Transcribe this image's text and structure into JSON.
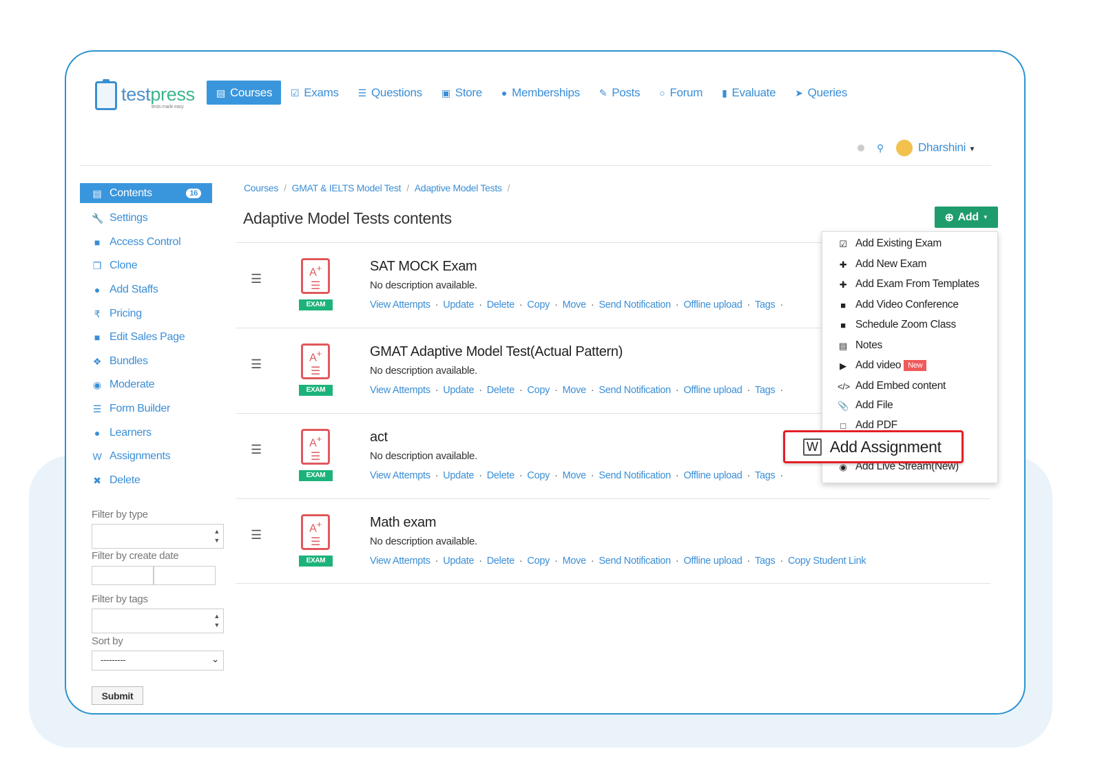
{
  "brand": {
    "name_a": "test",
    "name_b": "press",
    "tagline": "tests made easy",
    "accent": "#3a96dc",
    "green": "#1e9c6c"
  },
  "nav": [
    {
      "label": "Courses",
      "icon": "book-icon",
      "active": true
    },
    {
      "label": "Exams",
      "icon": "clipboard-check-icon"
    },
    {
      "label": "Questions",
      "icon": "list-icon"
    },
    {
      "label": "Store",
      "icon": "archive-icon"
    },
    {
      "label": "Memberships",
      "icon": "users-icon"
    },
    {
      "label": "Posts",
      "icon": "edit-icon"
    },
    {
      "label": "Forum",
      "icon": "comments-icon"
    },
    {
      "label": "Evaluate",
      "icon": "file-icon"
    },
    {
      "label": "Queries",
      "icon": "rocket-icon"
    }
  ],
  "user": {
    "name": "Dharshini"
  },
  "sidebar": {
    "items": [
      {
        "label": "Contents",
        "icon": "book-icon",
        "badge": "16",
        "active": true
      },
      {
        "label": "Settings",
        "icon": "wrench-icon"
      },
      {
        "label": "Access Control",
        "icon": "lock-icon"
      },
      {
        "label": "Clone",
        "icon": "copy-icon"
      },
      {
        "label": "Add Staffs",
        "icon": "user-plus-icon"
      },
      {
        "label": "Pricing",
        "icon": "rupee-icon"
      },
      {
        "label": "Edit Sales Page",
        "icon": "shopping-bag-icon"
      },
      {
        "label": "Bundles",
        "icon": "cubes-icon"
      },
      {
        "label": "Moderate",
        "icon": "eye-icon"
      },
      {
        "label": "Form Builder",
        "icon": "list-icon"
      },
      {
        "label": "Learners",
        "icon": "users-icon"
      },
      {
        "label": "Assignments",
        "icon": "word-file-icon"
      },
      {
        "label": "Delete",
        "icon": "times-circle-icon"
      }
    ]
  },
  "filters": {
    "type_label": "Filter by type",
    "date_label": "Filter by create date",
    "tags_label": "Filter by tags",
    "sort_label": "Sort by",
    "sort_value": "---------",
    "submit": "Submit"
  },
  "breadcrumb": [
    "Courses",
    "GMAT & IELTS Model Test",
    "Adaptive Model Tests"
  ],
  "page_title": "Adaptive Model Tests contents",
  "add_button": "Add",
  "exam_label": "EXAM",
  "rows": [
    {
      "name": "SAT MOCK Exam",
      "desc": "No description available."
    },
    {
      "name": "GMAT Adaptive Model Test(Actual Pattern)",
      "desc": "No description available."
    },
    {
      "name": "act",
      "desc": "No description available."
    },
    {
      "name": "Math exam",
      "desc": "No description available."
    }
  ],
  "actions": [
    "View Attempts",
    "Update",
    "Delete",
    "Copy",
    "Move",
    "Send Notification",
    "Offline upload",
    "Tags",
    "Copy Student Link"
  ],
  "menu": [
    {
      "label": "Add Existing Exam",
      "icon": "clipboard-check-icon"
    },
    {
      "label": "Add New Exam",
      "icon": "plus-icon"
    },
    {
      "label": "Add Exam From Templates",
      "icon": "plus-icon"
    },
    {
      "label": "Add Video Conference",
      "icon": "video-camera-icon"
    },
    {
      "label": "Schedule Zoom Class",
      "icon": "video-camera-icon"
    },
    {
      "label": "Notes",
      "icon": "book-icon"
    },
    {
      "label": "Add video",
      "icon": "play-circle-icon",
      "badge": "New"
    },
    {
      "label": "Add Embed content",
      "icon": "code-icon"
    },
    {
      "label": "Add File",
      "icon": "paperclip-icon"
    },
    {
      "label": "Add PDF",
      "icon": "pdf-file-icon"
    },
    {
      "label": "Add Live Stream(New)",
      "icon": "dot-circle-icon"
    }
  ],
  "highlight": {
    "label": "Add Assignment",
    "icon": "word-file-icon"
  }
}
